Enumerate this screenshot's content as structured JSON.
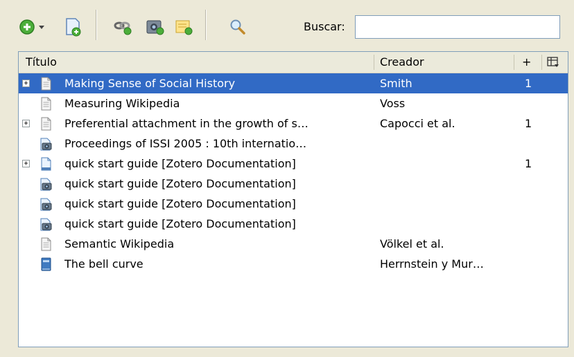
{
  "toolbar": {
    "search_label": "Buscar:",
    "search_value": "",
    "icons": [
      "new-item-icon",
      "dropdown-arrow-icon",
      "new-item-from-page-icon",
      "link-page-icon",
      "snapshot-icon",
      "new-note-icon",
      "advanced-search-icon"
    ]
  },
  "columns": {
    "title": "Título",
    "creator": "Creador",
    "notes": "+"
  },
  "rows": [
    {
      "title": "Making Sense of Social History",
      "creator": "Smith",
      "notes": "1",
      "icon": "document-icon",
      "twisty": "+"
    },
    {
      "title": "Measuring Wikipedia",
      "creator": "Voss",
      "notes": "",
      "icon": "document-icon",
      "twisty": ""
    },
    {
      "title": "Preferential attachment in the growth of s…",
      "creator": "Capocci et al.",
      "notes": "1",
      "icon": "document-icon",
      "twisty": "+"
    },
    {
      "title": "Proceedings of ISSI 2005 : 10th internatio…",
      "creator": "",
      "notes": "",
      "icon": "snapshot-icon",
      "twisty": ""
    },
    {
      "title": "quick start guide [Zotero Documentation]",
      "creator": "",
      "notes": "1",
      "icon": "webpage-icon",
      "twisty": "+"
    },
    {
      "title": "quick start guide [Zotero Documentation]",
      "creator": "",
      "notes": "",
      "icon": "snapshot-icon",
      "twisty": ""
    },
    {
      "title": "quick start guide [Zotero Documentation]",
      "creator": "",
      "notes": "",
      "icon": "snapshot-icon",
      "twisty": ""
    },
    {
      "title": "quick start guide [Zotero Documentation]",
      "creator": "",
      "notes": "",
      "icon": "snapshot-icon",
      "twisty": ""
    },
    {
      "title": "Semantic Wikipedia",
      "creator": "Völkel et al.",
      "notes": "",
      "icon": "document-icon",
      "twisty": ""
    },
    {
      "title": "The bell curve",
      "creator": "Herrnstein y Mur…",
      "notes": "",
      "icon": "book-icon",
      "twisty": ""
    }
  ],
  "colors": {
    "selection": "#316ac5",
    "background": "#ece9d8",
    "border": "#7f9db9"
  }
}
